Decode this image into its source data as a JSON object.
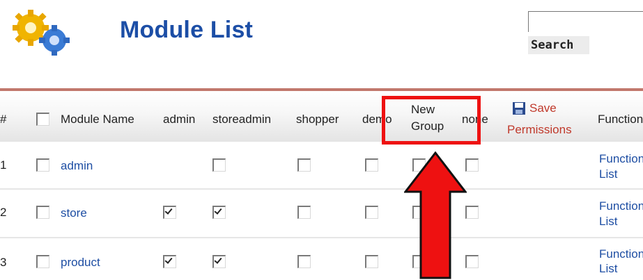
{
  "header": {
    "title": "Module List"
  },
  "search": {
    "button_label": "Search",
    "value": ""
  },
  "table": {
    "columns": {
      "number": "#",
      "module_name": "Module Name",
      "admin": "admin",
      "storeadmin": "storeadmin",
      "shopper": "shopper",
      "demo": "demo",
      "new_group_line1": "New",
      "new_group_line2": "Group",
      "none": "none",
      "save_line1": "Save",
      "save_line2": "Permissions",
      "functions": "Functions"
    },
    "rows": [
      {
        "num": "1",
        "name": "admin",
        "link_line1": "Functions",
        "link_line2": "List",
        "admin": false,
        "storeadmin": false,
        "shopper": false,
        "demo": false,
        "new_group": false,
        "none": false
      },
      {
        "num": "2",
        "name": "store",
        "link_line1": "Functions",
        "link_line2": "List",
        "admin": true,
        "storeadmin": true,
        "shopper": false,
        "demo": false,
        "new_group": false,
        "none": false
      },
      {
        "num": "3",
        "name": "product",
        "link_line1": "Functions",
        "link_line2": "List",
        "admin": true,
        "storeadmin": true,
        "shopper": false,
        "demo": false,
        "new_group": false,
        "none": false
      }
    ]
  },
  "annotation": {
    "color": "#ee1111",
    "highlight_target": "New Group column"
  },
  "icons": {
    "logo": "gears-icon",
    "save": "floppy-disk-icon"
  }
}
